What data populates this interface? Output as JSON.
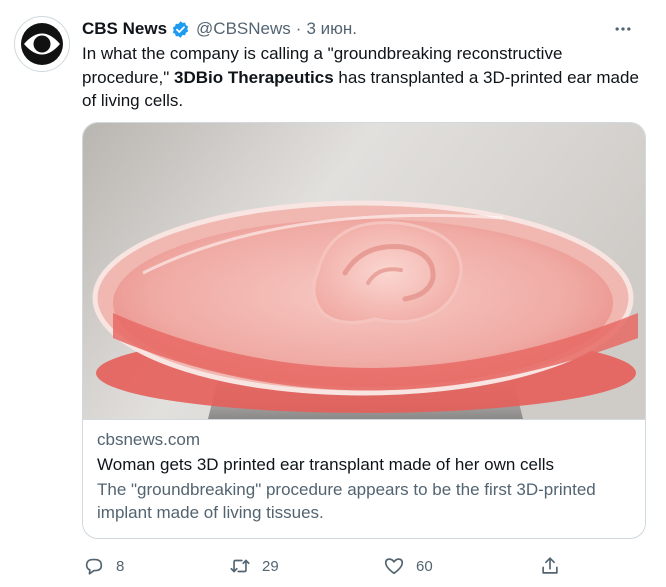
{
  "tweet": {
    "author_name": "CBS News",
    "handle": "@CBSNews",
    "separator": "·",
    "date": "3 июн.",
    "text_part1": "In what the company is calling a \"groundbreaking reconstructive procedure,\" ",
    "text_bold": "3DBio Therapeutics",
    "text_part2": " has transplanted a 3D-printed ear made of living cells."
  },
  "card": {
    "domain": "cbsnews.com",
    "title": "Woman gets 3D printed ear transplant made of her own cells",
    "description": "The \"groundbreaking\" procedure appears to be the first 3D-printed implant made of living tissues."
  },
  "actions": {
    "reply_count": "8",
    "retweet_count": "29",
    "like_count": "60"
  },
  "icons": {
    "avatar": "cbs-eye-logo",
    "verified": "verified-badge-icon",
    "more": "more-icon",
    "reply": "reply-icon",
    "retweet": "retweet-icon",
    "like": "like-icon",
    "share": "share-icon"
  },
  "colors": {
    "verified": "#1d9bf0",
    "secondary_text": "#536471",
    "primary_text": "#0f1419",
    "border": "#cfd9de"
  }
}
